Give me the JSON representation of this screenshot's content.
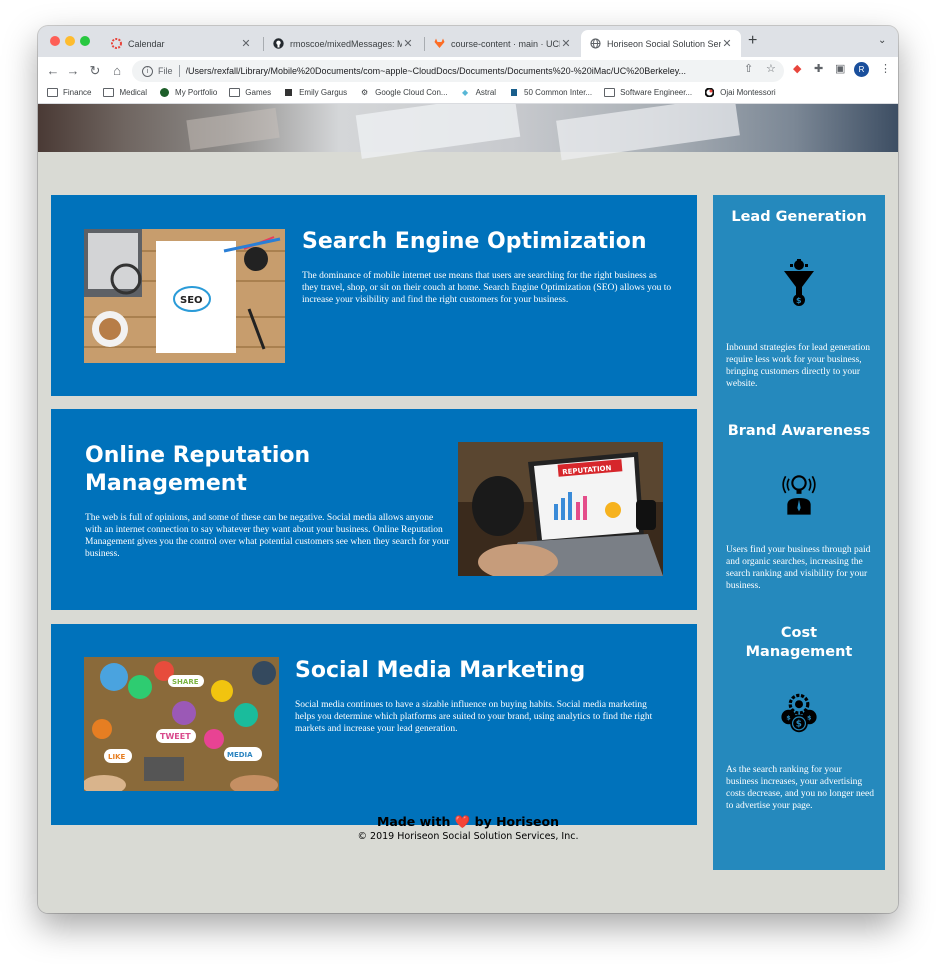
{
  "browser": {
    "tabs": [
      {
        "title": "Calendar",
        "icon": "calendar-icon"
      },
      {
        "title": "rmoscoe/mixedMessages: Mixed",
        "icon": "github-icon"
      },
      {
        "title": "course-content · main · UCB-Co",
        "icon": "gitlab-icon"
      },
      {
        "title": "Horiseon Social Solution Servic",
        "icon": "globe-icon",
        "active": true
      }
    ],
    "url_scheme": "File",
    "url": "/Users/rexfall/Library/Mobile%20Documents/com~apple~CloudDocs/Documents/Documents%20-%20iMac/UC%20Berkeley...",
    "profile_initial": "R",
    "bookmarks": [
      "Finance",
      "Medical",
      "My Portfolio",
      "Games",
      "Emily Gargus",
      "Google Cloud Con...",
      "Astral",
      "50 Common Inter...",
      "Software Engineer...",
      "Ojai Montessori"
    ]
  },
  "page": {
    "services": [
      {
        "title": "Search Engine Optimization",
        "text": "The dominance of mobile internet use means that users are searching for the right business as they travel, shop, or sit on their couch at home. Search Engine Optimization (SEO) allows you to increase your visibility and find the right customers for your business.",
        "image": "seo-notebook-image"
      },
      {
        "title": "Online Reputation Management",
        "text": "The web is full of opinions, and some of these can be negative. Social media allows anyone with an internet connection to say whatever they want about your business. Online Reputation Management gives you the control over what potential customers see when they search for your business.",
        "image": "reputation-laptop-image",
        "image_label": "REPUTATION"
      },
      {
        "title": "Social Media Marketing",
        "text": "Social media continues to have a sizable influence on buying habits. Social media marketing helps you determine which platforms are suited to your brand, using analytics to find the right markets and increase your lead generation.",
        "image": "social-media-image",
        "image_words": [
          "SHARE",
          "TWEET",
          "LIKE",
          "MEDIA"
        ]
      }
    ],
    "benefits": [
      {
        "title": "Lead Generation",
        "icon": "lead-funnel-icon",
        "text": "Inbound strategies for lead generation require less work for your business, bringing customers directly to your website."
      },
      {
        "title": "Brand Awareness",
        "icon": "lightbulb-person-icon",
        "text": "Users find your business through paid and organic searches, increasing the search ranking and visibility for your business."
      },
      {
        "title": "Cost Management",
        "icon": "cost-gears-icon",
        "text": "As the search ranking for your business increases, your advertising costs decrease, and you no longer need to advertise your page."
      }
    ],
    "footer": {
      "made_prefix": "Made with",
      "heart": "❤️",
      "made_suffix": "by Horiseon",
      "copyright": "© 2019 Horiseon Social Solution Services, Inc."
    }
  },
  "colors": {
    "card_blue": "#0072bb",
    "sidebar_blue": "#2589bd",
    "page_bg": "#d9dad4"
  }
}
